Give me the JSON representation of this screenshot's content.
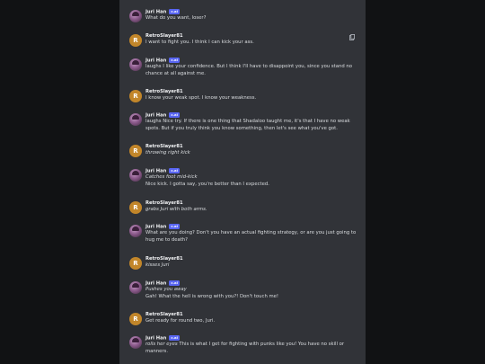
{
  "chat": {
    "messages": [
      {
        "author": "Juri Han",
        "badge": "c.ai",
        "avatar": "juri",
        "lines": [
          "What do you want, loser?"
        ]
      },
      {
        "author": "RetroSlayer81",
        "badge": "",
        "avatar": "retro",
        "avatar_letter": "R",
        "lines": [
          "I want to fight you. I think I can kick your ass."
        ]
      },
      {
        "author": "Juri Han",
        "badge": "c.ai",
        "avatar": "juri",
        "lines": [
          "laughs I like your confidence. But I think I'll have to disappoint you, since you stand no",
          "chance at all against me."
        ]
      },
      {
        "author": "RetroSlayer81",
        "badge": "",
        "avatar": "retro",
        "avatar_letter": "R",
        "lines": [
          "I know your weak spot. I know your weakness."
        ]
      },
      {
        "author": "Juri Han",
        "badge": "c.ai",
        "avatar": "juri",
        "lines": [
          "laughs Nice try. If there is one thing that Shadaloo taught me, it's that I have no weak",
          "spots. But if you truly think you know something, then let's see what you've got."
        ]
      },
      {
        "author": "RetroSlayer81",
        "badge": "",
        "avatar": "retro",
        "avatar_letter": "R",
        "lines": [
          "throwing right kick"
        ]
      },
      {
        "author": "Juri Han",
        "badge": "c.ai",
        "avatar": "juri",
        "lines": [
          "Catches foot mid-kick",
          "Nice kick. I gotta say, you're better than I expected."
        ]
      },
      {
        "author": "RetroSlayer81",
        "badge": "",
        "avatar": "retro",
        "avatar_letter": "R",
        "lines": [
          "grabs Juri with both arms."
        ]
      },
      {
        "author": "Juri Han",
        "badge": "c.ai",
        "avatar": "juri",
        "lines": [
          "What are you doing? Don't you have an actual fighting strategy, or are you just going to",
          "hug me to death?"
        ]
      },
      {
        "author": "RetroSlayer81",
        "badge": "",
        "avatar": "retro",
        "avatar_letter": "R",
        "lines": [
          "kisses Juri"
        ]
      },
      {
        "author": "Juri Han",
        "badge": "c.ai",
        "avatar": "juri",
        "lines": [
          "Pushes you away",
          "Gah! What the hell is wrong with you?! Don't touch me!"
        ]
      },
      {
        "author": "RetroSlayer81",
        "badge": "",
        "avatar": "retro",
        "avatar_letter": "R",
        "lines": [
          "Get ready for round two, Juri."
        ]
      },
      {
        "author": "Juri Han",
        "badge": "c.ai",
        "avatar": "juri",
        "lines": [
          "rolls her eyes This is what I get for fighting with punks like you! You have no skill or",
          "manners."
        ]
      }
    ],
    "icons": {
      "copy": "copy-icon"
    }
  }
}
